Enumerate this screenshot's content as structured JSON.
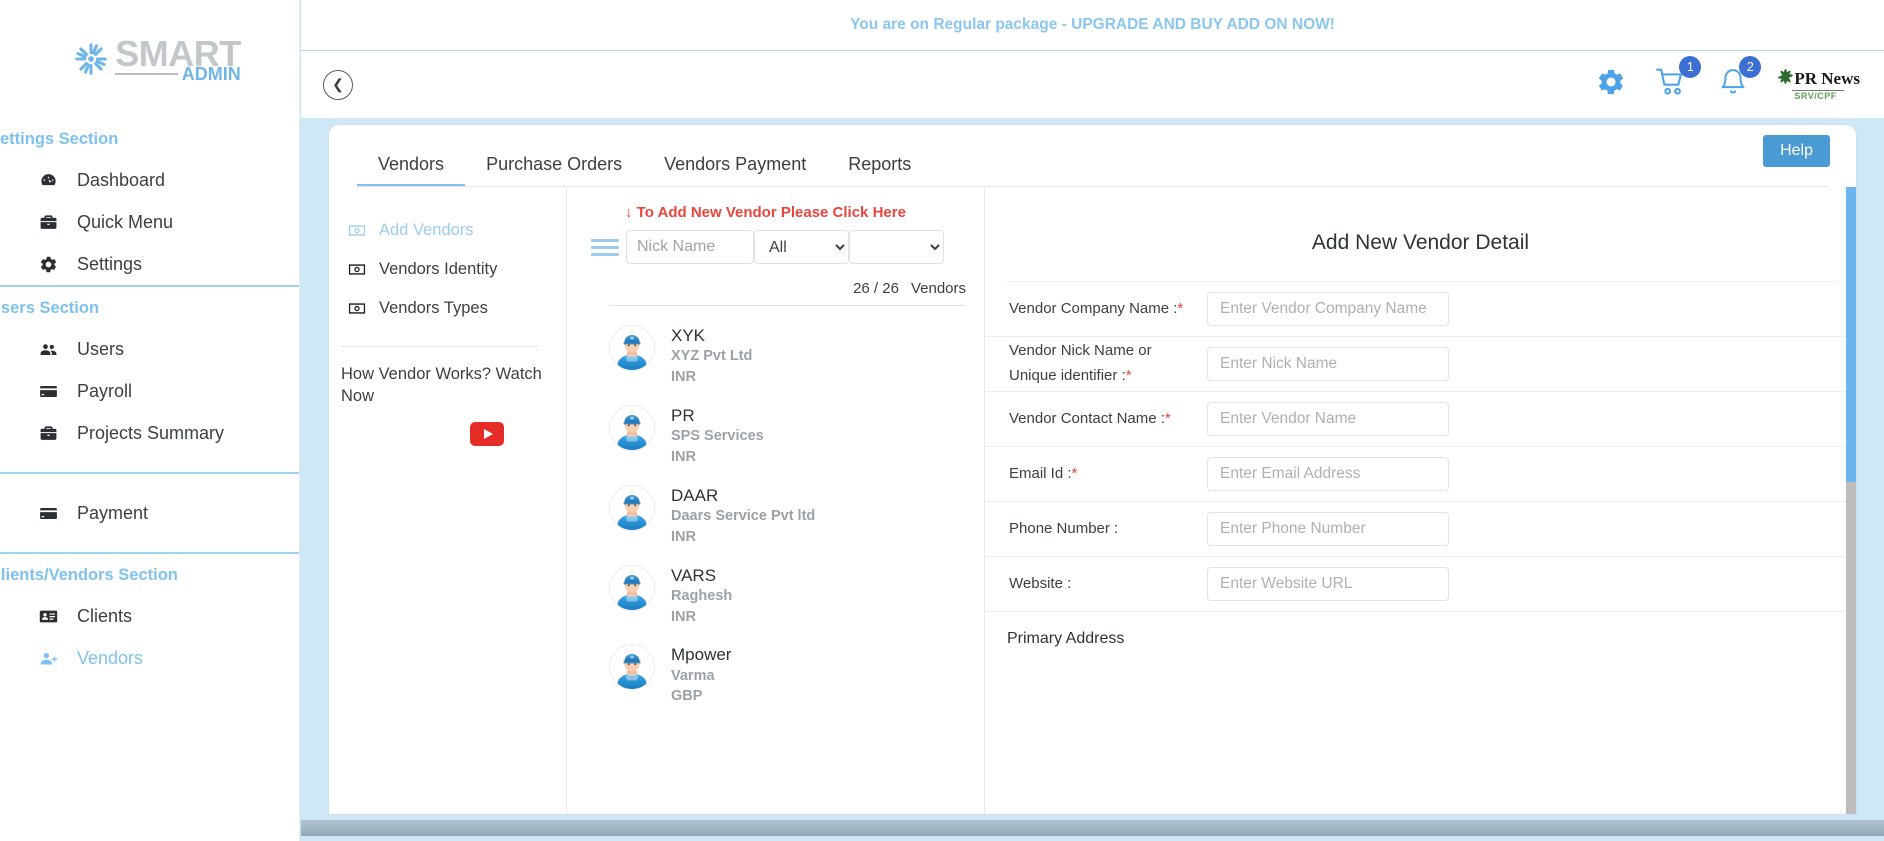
{
  "brand": {
    "name_main": "SMART",
    "name_sub": "ADMIN",
    "accent": "#7ec2ef"
  },
  "sidebar": {
    "sections": [
      {
        "title": "Settings Section",
        "items": [
          {
            "label": "Dashboard",
            "icon": "dashboard-icon",
            "active": false
          },
          {
            "label": "Quick Menu",
            "icon": "briefcase-icon",
            "active": false
          },
          {
            "label": "Settings",
            "icon": "gear-icon",
            "active": false
          }
        ]
      },
      {
        "title": "Users Section",
        "items": [
          {
            "label": "Users",
            "icon": "users-icon",
            "active": false
          },
          {
            "label": "Payroll",
            "icon": "card-icon",
            "active": false
          },
          {
            "label": "Projects Summary",
            "icon": "briefcase-icon",
            "active": false
          }
        ]
      },
      {
        "title": "",
        "items": [
          {
            "label": "Payment",
            "icon": "card-icon",
            "active": false
          }
        ]
      },
      {
        "title": "Clients/Vendors Section",
        "items": [
          {
            "label": "Clients",
            "icon": "contact-card-icon",
            "active": false
          },
          {
            "label": "Vendors",
            "icon": "user-plus-icon",
            "active": true
          }
        ]
      }
    ]
  },
  "promo": {
    "text": "You are on Regular package - UPGRADE AND BUY ADD ON NOW!"
  },
  "topbar": {
    "collapse_icon": "chevron-left-icon",
    "gear_icon": "gear-icon",
    "cart_icon": "cart-icon",
    "cart_badge": "1",
    "bell_icon": "bell-icon",
    "bell_badge": "2",
    "logo_name": "PR News",
    "logo_sub": "SRV/CPF"
  },
  "tabs": [
    {
      "label": "Vendors",
      "active": true
    },
    {
      "label": "Purchase Orders",
      "active": false
    },
    {
      "label": "Vendors Payment",
      "active": false
    },
    {
      "label": "Reports",
      "active": false
    }
  ],
  "help_button": "Help",
  "left_panel": {
    "links": [
      {
        "label": "Add Vendors",
        "icon": "money-note-icon",
        "active": true
      },
      {
        "label": "Vendors Identity",
        "icon": "money-note-icon",
        "active": false
      },
      {
        "label": "Vendors Types",
        "icon": "money-note-icon",
        "active": false
      }
    ],
    "watch_text": "How Vendor Works? Watch Now",
    "youtube_icon": "youtube-play-icon"
  },
  "mid_panel": {
    "add_hint": "↓ To Add New Vendor Please Click Here",
    "menu_icon": "hamburger-icon",
    "nick_placeholder": "Nick Name",
    "nick_value": "",
    "type_selected": "All",
    "type_options": [
      "All"
    ],
    "extra_selected": "",
    "extra_options": [
      ""
    ],
    "count": "26 / 26",
    "count_label": "Vendors",
    "vendors": [
      {
        "nick": "XYK",
        "company": "XYZ Pvt Ltd",
        "currency": "INR"
      },
      {
        "nick": "PR",
        "company": "SPS Services",
        "currency": "INR"
      },
      {
        "nick": "DAAR",
        "company": "Daars Service Pvt ltd",
        "currency": "INR"
      },
      {
        "nick": "VARS",
        "company": "Raghesh",
        "currency": "INR"
      },
      {
        "nick": "Mpower",
        "company": "Varma",
        "currency": "GBP"
      }
    ]
  },
  "form": {
    "title": "Add New Vendor Detail",
    "fields": [
      {
        "label": "Vendor Company Name :",
        "required": true,
        "placeholder": "Enter Vendor Company Name",
        "value": ""
      },
      {
        "label": "Vendor Nick Name or Unique identifier :",
        "required": true,
        "placeholder": "Enter Nick Name",
        "value": "",
        "two_line": true
      },
      {
        "label": "Vendor Contact Name :",
        "required": true,
        "placeholder": "Enter Vendor Name",
        "value": ""
      },
      {
        "label": "Email Id :",
        "required": true,
        "placeholder": "Enter Email Address",
        "value": ""
      },
      {
        "label": "Phone Number :",
        "required": false,
        "placeholder": "Enter Phone Number",
        "value": ""
      },
      {
        "label": "Website :",
        "required": false,
        "placeholder": "Enter Website URL",
        "value": ""
      }
    ],
    "section_heading": "Primary Address"
  }
}
